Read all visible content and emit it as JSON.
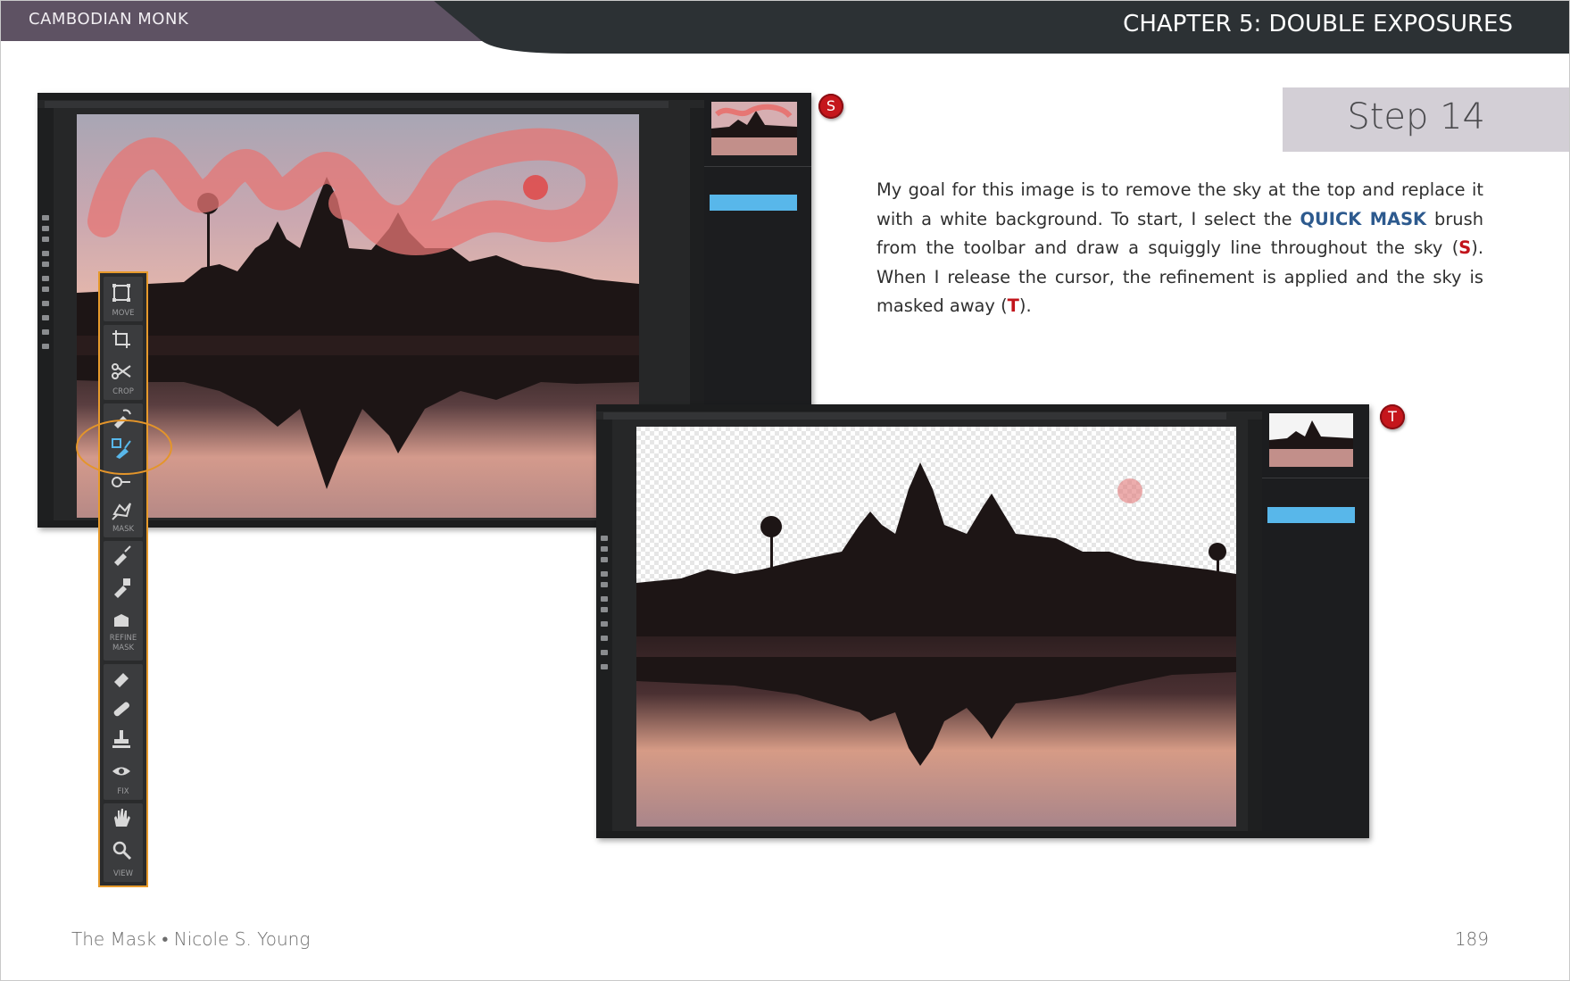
{
  "header": {
    "section": "CAMBODIAN MONK",
    "chapter": "CHAPTER 5: DOUBLE EXPOSURES"
  },
  "step": {
    "title": "Step 14"
  },
  "body": {
    "p1": "My goal for this image is to remove the sky at the top and replace it with a white background. To start, I select the ",
    "quick_mask": "QUICK MASK",
    "p2": " brush from the toolbar and draw a squiggly line throughout the sky (",
    "ref_s": "S",
    "p3": "). When I release the cursor, the refinement is applied and the sky is masked away (",
    "ref_t": "T",
    "p4": ")."
  },
  "badges": {
    "s": "S",
    "t": "T"
  },
  "toolbar": {
    "move": "MOVE",
    "crop": "CROP",
    "mask": "MASK",
    "refine_mask_1": "REFINE",
    "refine_mask_2": "MASK",
    "fix": "FIX",
    "view": "VIEW"
  },
  "footer": {
    "left": "The Mask • Nicole S. Young",
    "page": "189"
  },
  "colors": {
    "header_dark": "#2c3134",
    "header_purple": "#5e5263",
    "accent_blue": "#2d5a8e",
    "ref_red": "#c2141b",
    "highlight_orange": "#e79a2b",
    "layer_selected": "#58b7ea"
  }
}
